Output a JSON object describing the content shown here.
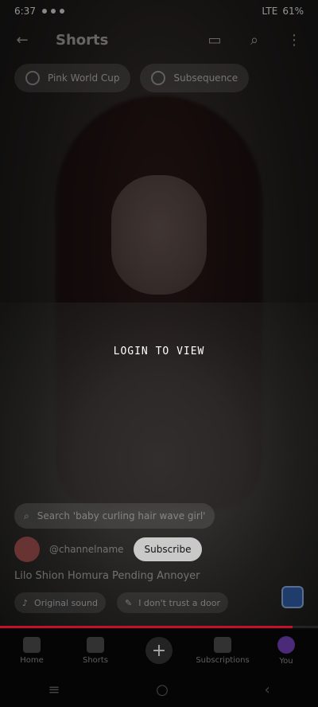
{
  "status": {
    "time": "6:37",
    "signal_text": "LTE",
    "battery_text": "61%"
  },
  "header": {
    "title": "Shorts",
    "back_icon": "arrow-left-icon",
    "camera_icon": "video-camera-icon",
    "search_icon": "search-icon",
    "more_icon": "more-vert-icon"
  },
  "chips": [
    {
      "label": "Pink World Cup",
      "icon": "circle-icon"
    },
    {
      "label": "Subsequence",
      "icon": "circle-icon"
    }
  ],
  "center_message": "LOGIN TO VIEW",
  "search_chip": {
    "label": "Search 'baby curling hair wave girl'",
    "icon": "search-icon"
  },
  "channel": {
    "name": "@channelname",
    "subscribe_label": "Subscribe"
  },
  "description": "Lilo Shion Homura Pending Annoyer",
  "links": [
    {
      "label": "Original sound",
      "icon": "music-icon"
    },
    {
      "label": "I don't trust a door",
      "icon": "edit-icon"
    }
  ],
  "progress": {
    "fraction": 0.92,
    "color": "#c4102b"
  },
  "nav": {
    "home": "Home",
    "shorts": "Shorts",
    "subscriptions": "Subscriptions",
    "you": "You"
  },
  "system_nav": {
    "recent_icon": "recent-apps-icon",
    "home_icon": "home-circle-icon",
    "back_icon": "back-chevron-icon"
  }
}
